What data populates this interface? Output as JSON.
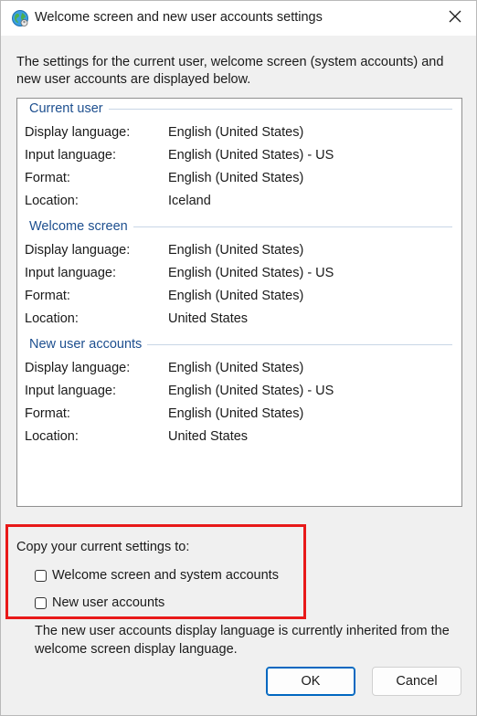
{
  "window": {
    "title": "Welcome screen and new user accounts settings",
    "icon": "globe-icon",
    "close_icon": "close-icon"
  },
  "intro": "The settings for the current user, welcome screen (system accounts) and new user accounts are displayed below.",
  "groups": [
    {
      "header": "Current user",
      "rows": [
        {
          "label": "Display language:",
          "value": "English (United States)"
        },
        {
          "label": "Input language:",
          "value": "English (United States) - US"
        },
        {
          "label": "Format:",
          "value": "English (United States)"
        },
        {
          "label": "Location:",
          "value": "Iceland"
        }
      ]
    },
    {
      "header": "Welcome screen",
      "rows": [
        {
          "label": "Display language:",
          "value": "English (United States)"
        },
        {
          "label": "Input language:",
          "value": "English (United States) - US"
        },
        {
          "label": "Format:",
          "value": "English (United States)"
        },
        {
          "label": "Location:",
          "value": "United States"
        }
      ]
    },
    {
      "header": "New user accounts",
      "rows": [
        {
          "label": "Display language:",
          "value": "English (United States)"
        },
        {
          "label": "Input language:",
          "value": "English (United States) - US"
        },
        {
          "label": "Format:",
          "value": "English (United States)"
        },
        {
          "label": "Location:",
          "value": "United States"
        }
      ]
    }
  ],
  "copy": {
    "label": "Copy your current settings to:",
    "options": [
      {
        "label": "Welcome screen and system accounts",
        "checked": false
      },
      {
        "label": "New user accounts",
        "checked": false
      }
    ]
  },
  "note": "The new user accounts display language is currently inherited from the welcome screen display language.",
  "buttons": {
    "ok": "OK",
    "cancel": "Cancel"
  },
  "colors": {
    "group_header": "#1d4f8f",
    "highlight": "#e81919",
    "ok_border": "#0067c0"
  }
}
